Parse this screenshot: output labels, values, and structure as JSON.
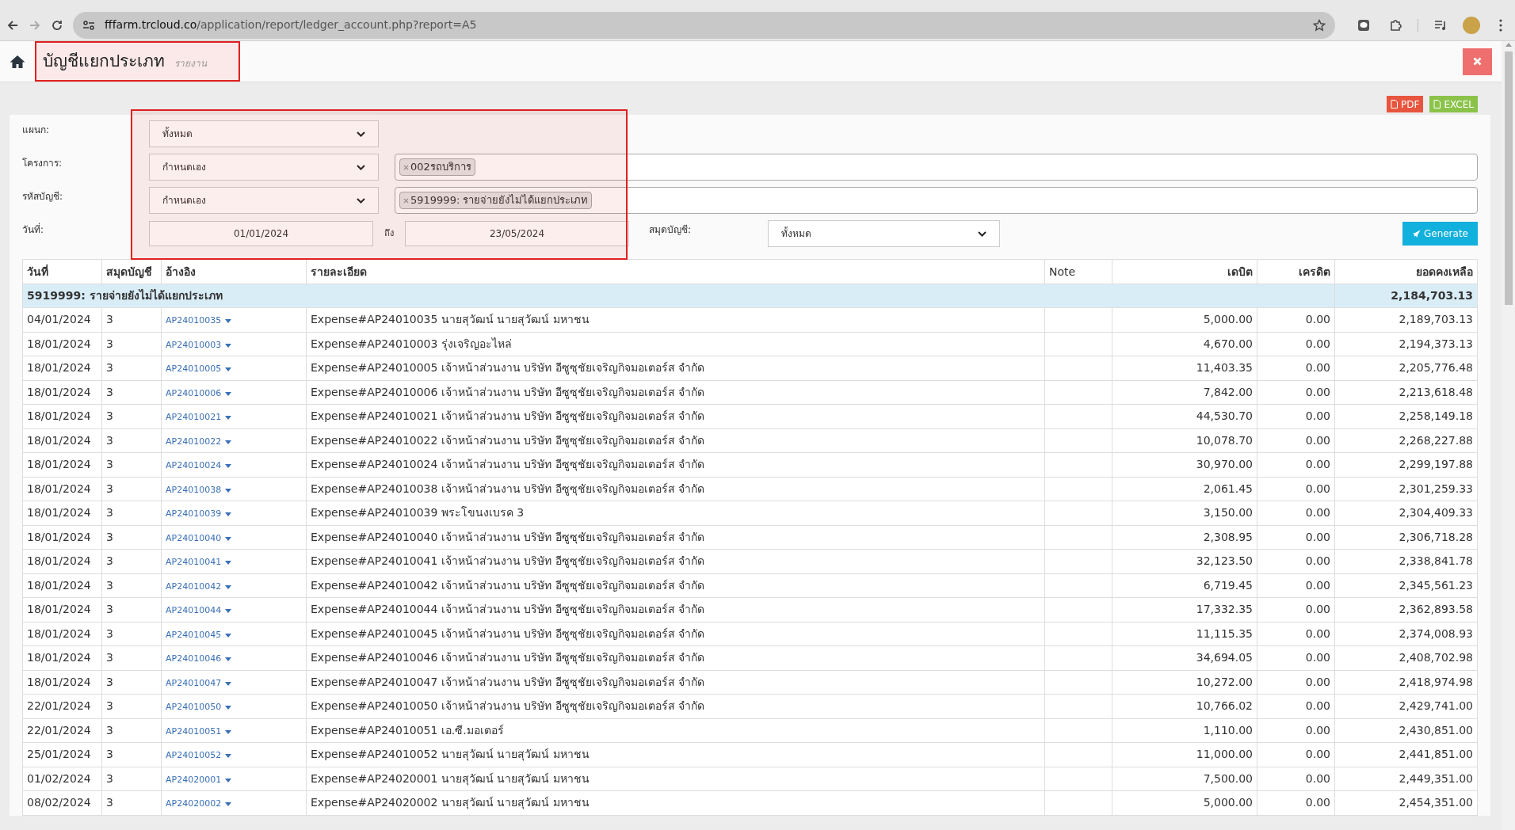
{
  "browser": {
    "url_host": "fffarm.trcloud.co",
    "url_path": "/application/report/ledger_account.php?report=A5"
  },
  "header": {
    "title": "บัญชีแยกประเภท",
    "subtitle": "รายงาน"
  },
  "export_buttons": [
    "PDF",
    "EXCEL"
  ],
  "filters": {
    "department": {
      "label": "แผนก:",
      "value": "ทั้งหมด"
    },
    "project": {
      "label": "โครงการ:",
      "value": "กำหนดเอง",
      "tags": [
        "002รถบริการ"
      ]
    },
    "account": {
      "label": "รหัสบัญชี:",
      "value": "กำหนดเอง",
      "tags": [
        "5919999: รายจ่ายยังไม่ได้แยกประเภท"
      ]
    },
    "date": {
      "label": "วันที่:",
      "from": "01/01/2024",
      "to_label": "ถึง",
      "to": "23/05/2024"
    },
    "book": {
      "label": "สมุดบัญชี:",
      "value": "ทั้งหมด"
    },
    "generate": "Generate"
  },
  "table": {
    "columns": [
      "วันที่",
      "สมุดบัญชี",
      "อ้างอิง",
      "รายละเอียด",
      "Note",
      "เดบิต",
      "เครดิต",
      "ยอดคงเหลือ"
    ],
    "group": {
      "label": "5919999: รายจ่ายยังไม่ได้แยกประเภท",
      "balance": "2,184,703.13"
    },
    "rows": [
      {
        "date": "04/01/2024",
        "book": "3",
        "ref": "AP24010035",
        "detail": "Expense#AP24010035 นายสุวัฒน์ นายสุวัฒน์ มหาชน",
        "debit": "5,000.00",
        "credit": "0.00",
        "balance": "2,189,703.13"
      },
      {
        "date": "18/01/2024",
        "book": "3",
        "ref": "AP24010003",
        "detail": "Expense#AP24010003 รุ่งเจริญอะไหล่",
        "debit": "4,670.00",
        "credit": "0.00",
        "balance": "2,194,373.13"
      },
      {
        "date": "18/01/2024",
        "book": "3",
        "ref": "AP24010005",
        "detail": "Expense#AP24010005 เจ้าหน้าส่วนงาน บริษัท อีซูซุชัยเจริญกิจมอเตอร์ส จำกัด",
        "debit": "11,403.35",
        "credit": "0.00",
        "balance": "2,205,776.48"
      },
      {
        "date": "18/01/2024",
        "book": "3",
        "ref": "AP24010006",
        "detail": "Expense#AP24010006 เจ้าหน้าส่วนงาน บริษัท อีซูซุชัยเจริญกิจมอเตอร์ส จำกัด",
        "debit": "7,842.00",
        "credit": "0.00",
        "balance": "2,213,618.48"
      },
      {
        "date": "18/01/2024",
        "book": "3",
        "ref": "AP24010021",
        "detail": "Expense#AP24010021 เจ้าหน้าส่วนงาน บริษัท อีซูซุชัยเจริญกิจมอเตอร์ส จำกัด",
        "debit": "44,530.70",
        "credit": "0.00",
        "balance": "2,258,149.18"
      },
      {
        "date": "18/01/2024",
        "book": "3",
        "ref": "AP24010022",
        "detail": "Expense#AP24010022 เจ้าหน้าส่วนงาน บริษัท อีซูซุชัยเจริญกิจมอเตอร์ส จำกัด",
        "debit": "10,078.70",
        "credit": "0.00",
        "balance": "2,268,227.88"
      },
      {
        "date": "18/01/2024",
        "book": "3",
        "ref": "AP24010024",
        "detail": "Expense#AP24010024 เจ้าหน้าส่วนงาน บริษัท อีซูซุชัยเจริญกิจมอเตอร์ส จำกัด",
        "debit": "30,970.00",
        "credit": "0.00",
        "balance": "2,299,197.88"
      },
      {
        "date": "18/01/2024",
        "book": "3",
        "ref": "AP24010038",
        "detail": "Expense#AP24010038 เจ้าหน้าส่วนงาน บริษัท อีซูซุชัยเจริญกิจมอเตอร์ส จำกัด",
        "debit": "2,061.45",
        "credit": "0.00",
        "balance": "2,301,259.33"
      },
      {
        "date": "18/01/2024",
        "book": "3",
        "ref": "AP24010039",
        "detail": "Expense#AP24010039 พระโขนงเบรค 3",
        "debit": "3,150.00",
        "credit": "0.00",
        "balance": "2,304,409.33"
      },
      {
        "date": "18/01/2024",
        "book": "3",
        "ref": "AP24010040",
        "detail": "Expense#AP24010040 เจ้าหน้าส่วนงาน บริษัท อีซูซุชัยเจริญกิจมอเตอร์ส จำกัด",
        "debit": "2,308.95",
        "credit": "0.00",
        "balance": "2,306,718.28"
      },
      {
        "date": "18/01/2024",
        "book": "3",
        "ref": "AP24010041",
        "detail": "Expense#AP24010041 เจ้าหน้าส่วนงาน บริษัท อีซูซุชัยเจริญกิจมอเตอร์ส จำกัด",
        "debit": "32,123.50",
        "credit": "0.00",
        "balance": "2,338,841.78"
      },
      {
        "date": "18/01/2024",
        "book": "3",
        "ref": "AP24010042",
        "detail": "Expense#AP24010042 เจ้าหน้าส่วนงาน บริษัท อีซูซุชัยเจริญกิจมอเตอร์ส จำกัด",
        "debit": "6,719.45",
        "credit": "0.00",
        "balance": "2,345,561.23"
      },
      {
        "date": "18/01/2024",
        "book": "3",
        "ref": "AP24010044",
        "detail": "Expense#AP24010044 เจ้าหน้าส่วนงาน บริษัท อีซูซุชัยเจริญกิจมอเตอร์ส จำกัด",
        "debit": "17,332.35",
        "credit": "0.00",
        "balance": "2,362,893.58"
      },
      {
        "date": "18/01/2024",
        "book": "3",
        "ref": "AP24010045",
        "detail": "Expense#AP24010045 เจ้าหน้าส่วนงาน บริษัท อีซูซุชัยเจริญกิจมอเตอร์ส จำกัด",
        "debit": "11,115.35",
        "credit": "0.00",
        "balance": "2,374,008.93"
      },
      {
        "date": "18/01/2024",
        "book": "3",
        "ref": "AP24010046",
        "detail": "Expense#AP24010046 เจ้าหน้าส่วนงาน บริษัท อีซูซุชัยเจริญกิจมอเตอร์ส จำกัด",
        "debit": "34,694.05",
        "credit": "0.00",
        "balance": "2,408,702.98"
      },
      {
        "date": "18/01/2024",
        "book": "3",
        "ref": "AP24010047",
        "detail": "Expense#AP24010047 เจ้าหน้าส่วนงาน บริษัท อีซูซุชัยเจริญกิจมอเตอร์ส จำกัด",
        "debit": "10,272.00",
        "credit": "0.00",
        "balance": "2,418,974.98"
      },
      {
        "date": "22/01/2024",
        "book": "3",
        "ref": "AP24010050",
        "detail": "Expense#AP24010050 เจ้าหน้าส่วนงาน บริษัท อีซูซุชัยเจริญกิจมอเตอร์ส จำกัด",
        "debit": "10,766.02",
        "credit": "0.00",
        "balance": "2,429,741.00"
      },
      {
        "date": "22/01/2024",
        "book": "3",
        "ref": "AP24010051",
        "detail": "Expense#AP24010051 เอ.ซี.มอเตอร์",
        "debit": "1,110.00",
        "credit": "0.00",
        "balance": "2,430,851.00"
      },
      {
        "date": "25/01/2024",
        "book": "3",
        "ref": "AP24010052",
        "detail": "Expense#AP24010052 นายสุวัฒน์ นายสุวัฒน์ มหาชน",
        "debit": "11,000.00",
        "credit": "0.00",
        "balance": "2,441,851.00"
      },
      {
        "date": "01/02/2024",
        "book": "3",
        "ref": "AP24020001",
        "detail": "Expense#AP24020001 นายสุวัฒน์ นายสุวัฒน์ มหาชน",
        "debit": "7,500.00",
        "credit": "0.00",
        "balance": "2,449,351.00"
      },
      {
        "date": "08/02/2024",
        "book": "3",
        "ref": "AP24020002",
        "detail": "Expense#AP24020002 นายสุวัฒน์ นายสุวัฒน์ มหาชน",
        "debit": "5,000.00",
        "credit": "0.00",
        "balance": "2,454,351.00"
      }
    ]
  }
}
